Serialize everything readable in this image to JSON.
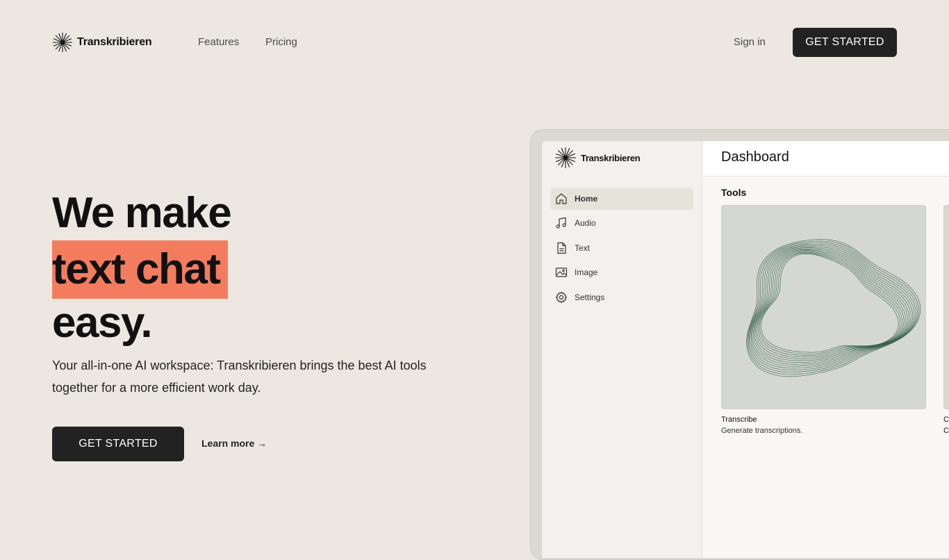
{
  "brand": {
    "name": "Transkribieren"
  },
  "nav": {
    "links": [
      "Features",
      "Pricing"
    ],
    "sign_in": "Sign in",
    "cta": "GET STARTED"
  },
  "hero": {
    "title_line1": "We make",
    "title_highlight": "text chat",
    "title_line3": "easy.",
    "subtitle": "Your all-in-one AI workspace: Transkribieren brings the best AI tools together for a more efficient work day.",
    "cta": "GET STARTED",
    "learn_more": "Learn more →"
  },
  "app": {
    "brand": "Transkribieren",
    "header_title": "Dashboard",
    "sidebar": [
      {
        "label": "Home",
        "icon": "home-icon",
        "active": true
      },
      {
        "label": "Audio",
        "icon": "music-note-icon",
        "active": false
      },
      {
        "label": "Text",
        "icon": "document-icon",
        "active": false
      },
      {
        "label": "Image",
        "icon": "image-icon",
        "active": false
      },
      {
        "label": "Settings",
        "icon": "gear-icon",
        "active": false
      }
    ],
    "tools_label": "Tools",
    "tools": [
      {
        "title": "Transcribe",
        "description": "Generate transcriptions."
      },
      {
        "title": "Cl",
        "description": "Cl"
      }
    ]
  },
  "colors": {
    "background": "#ece8e1",
    "highlight": "#f47c5e",
    "button": "#222222",
    "wave": "#2f5a44"
  }
}
